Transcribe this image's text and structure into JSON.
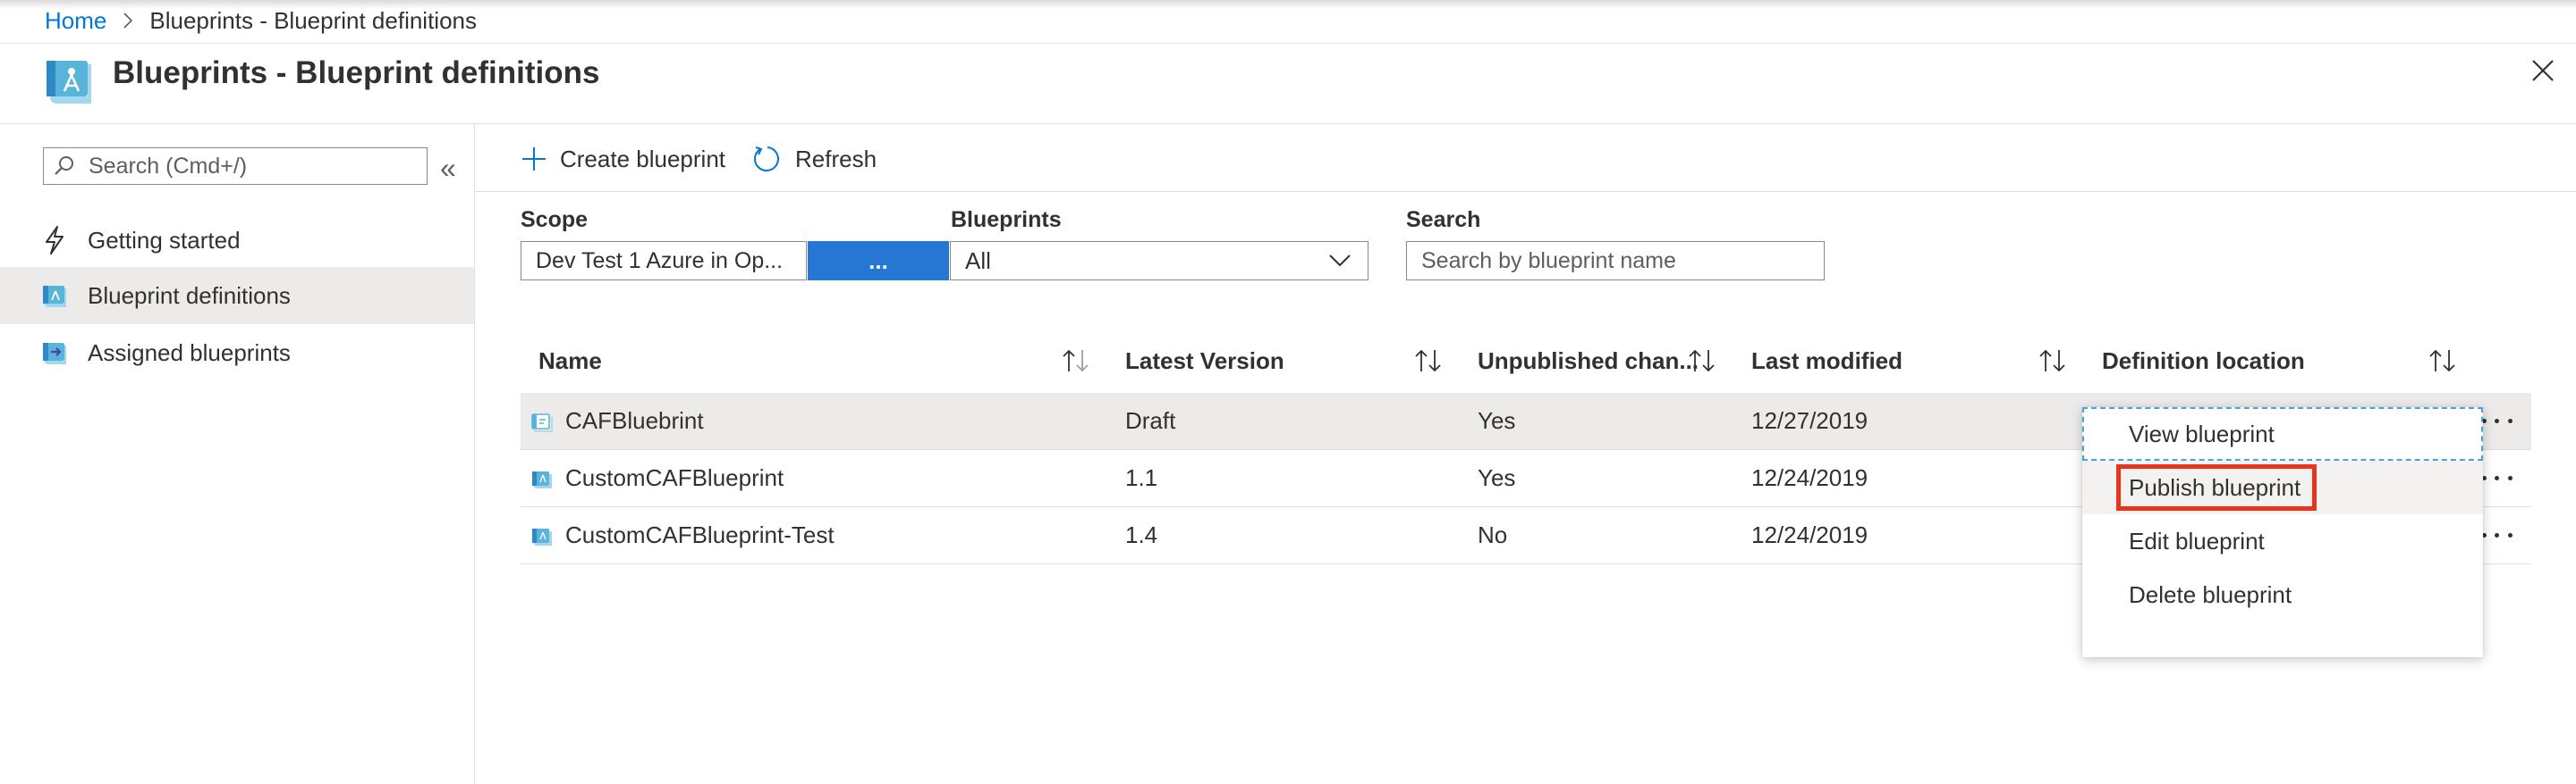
{
  "breadcrumb": {
    "home": "Home",
    "current": "Blueprints - Blueprint definitions"
  },
  "header": {
    "title": "Blueprints - Blueprint definitions",
    "icon": "blueprint-icon"
  },
  "sidebar": {
    "search_placeholder": "Search (Cmd+/)",
    "collapse_glyph": "«",
    "items": [
      {
        "label": "Getting started",
        "icon": "lightning-icon",
        "active": false
      },
      {
        "label": "Blueprint definitions",
        "icon": "blueprint-definition-icon",
        "active": true
      },
      {
        "label": "Assigned blueprints",
        "icon": "assigned-blueprint-icon",
        "active": false
      }
    ]
  },
  "toolbar": {
    "create_label": "Create blueprint",
    "refresh_label": "Refresh"
  },
  "filters": {
    "scope_label": "Scope",
    "scope_value": "Dev Test 1 Azure in Op...",
    "scope_button": "...",
    "blueprints_label": "Blueprints",
    "blueprints_value": "All",
    "search_label": "Search",
    "search_placeholder": "Search by blueprint name"
  },
  "table": {
    "columns": [
      "Name",
      "Latest Version",
      "Unpublished chan...",
      "Last modified",
      "Definition location"
    ],
    "rows": [
      {
        "name": "CAFBluebrint",
        "version": "Draft",
        "unpublished": "Yes",
        "modified": "12/27/2019",
        "location": ""
      },
      {
        "name": "CustomCAFBlueprint",
        "version": "1.1",
        "unpublished": "Yes",
        "modified": "12/24/2019",
        "location": ""
      },
      {
        "name": "CustomCAFBlueprint-Test",
        "version": "1.4",
        "unpublished": "No",
        "modified": "12/24/2019",
        "location": ""
      }
    ]
  },
  "context_menu": {
    "items": [
      "View blueprint",
      "Publish blueprint",
      "Edit blueprint",
      "Delete blueprint"
    ],
    "highlight_color": "#e8331d"
  },
  "colors": {
    "accent": "#0078d4",
    "button": "#2677d4",
    "selected_row": "#edebe9"
  }
}
